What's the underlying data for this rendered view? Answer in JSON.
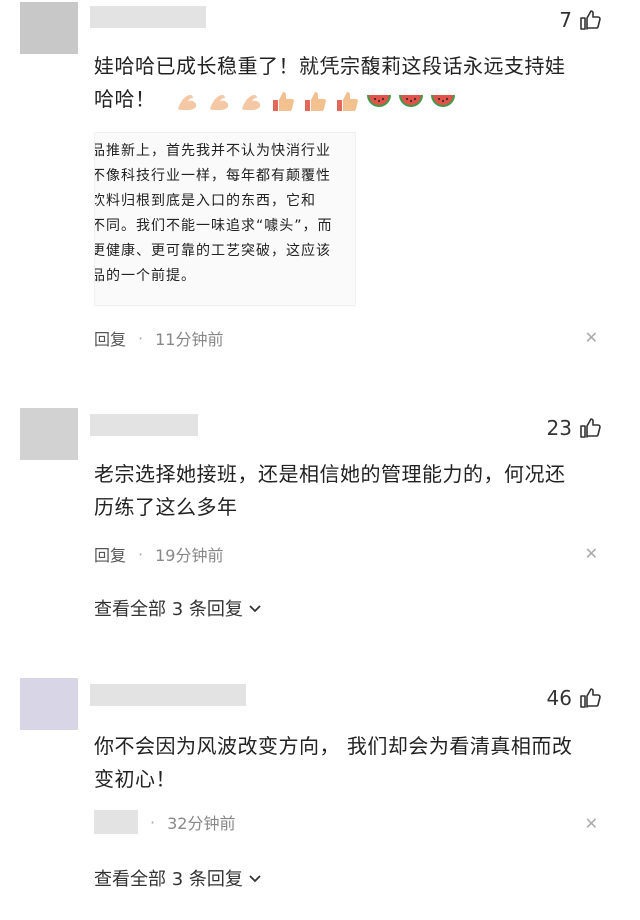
{
  "comments": [
    {
      "likes": "7",
      "text_line1": "娃哈哈已成长稳重了！就凭宗馥莉这段话永远支持娃",
      "text_line2": "哈哈！",
      "emoji_icons": [
        "muscle-icon",
        "muscle-icon",
        "muscle-icon",
        "thumbs-up-icon",
        "thumbs-up-icon",
        "thumbs-up-icon",
        "watermelon-icon",
        "watermelon-icon",
        "watermelon-icon"
      ],
      "quote_lines": [
        "品推新上，首先我并不认为快消行业",
        "不像科技行业一样，每年都有颠覆性",
        "饮料归根到底是入口的东西，它和",
        "不同。我们不能一味追求“噱头”，而",
        "更健康、更可靠的工艺突破，这应该",
        "品的一个前提。"
      ],
      "reply_label": "回复",
      "time": "11分钟前"
    },
    {
      "likes": "23",
      "text_line1": "老宗选择她接班，还是相信她的管理能力的，何况还",
      "text_line2": "历练了这么多年",
      "reply_label": "回复",
      "time": "19分钟前",
      "more_label": "查看全部 3 条回复"
    },
    {
      "likes": "46",
      "text_line1": "你不会因为风波改变方向，  我们却会为看清真相而改",
      "text_line2": "变初心！",
      "time": "32分钟前",
      "more_label": "查看全部 3 条回复"
    }
  ],
  "colors": {
    "avatar1": "#c8c8c8",
    "avatar2": "#d2d2d2",
    "avatar3": "#d8d6e6",
    "username_blur": "#e3e3e3",
    "watermelon": "#e0524a"
  }
}
